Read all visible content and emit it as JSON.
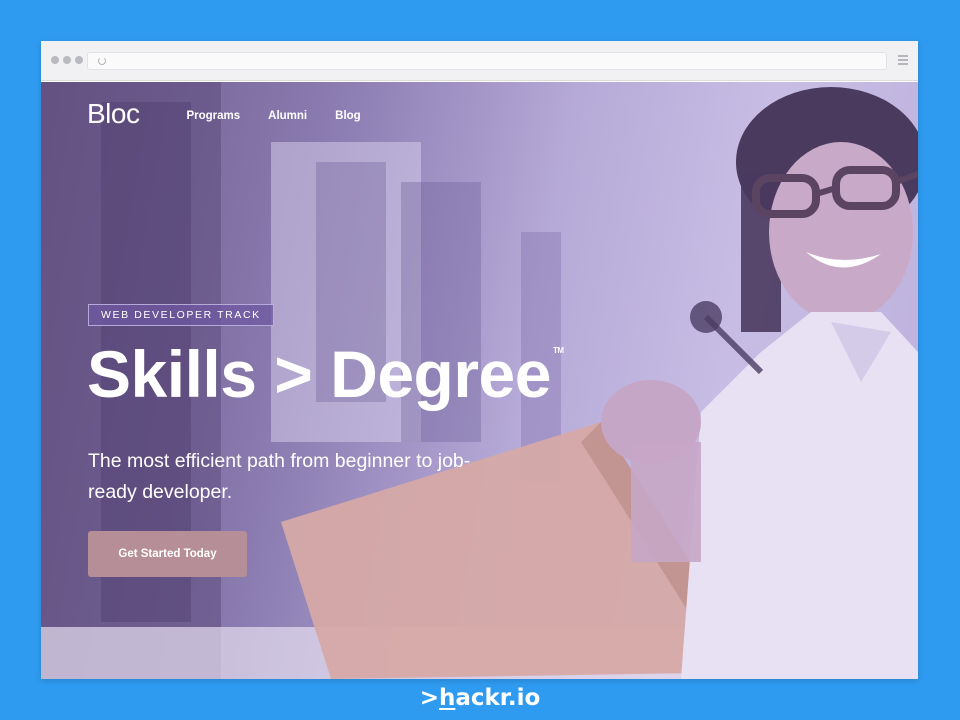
{
  "site": {
    "logo": "Bloc",
    "nav": [
      "Programs",
      "Alumni",
      "Blog"
    ]
  },
  "hero": {
    "badge": "WEB DEVELOPER TRACK",
    "headline": "Skills > Degree",
    "trademark": "TM",
    "subtext": "The most efficient path from beginner to job-ready developer.",
    "cta": "Get Started Today"
  },
  "footer": {
    "prefix": ">",
    "first_letter": "h",
    "rest": "ackr.io"
  },
  "colors": {
    "background": "#2f9bf0",
    "hero_tint": "#b6aad8",
    "cta": "#b58e97"
  }
}
